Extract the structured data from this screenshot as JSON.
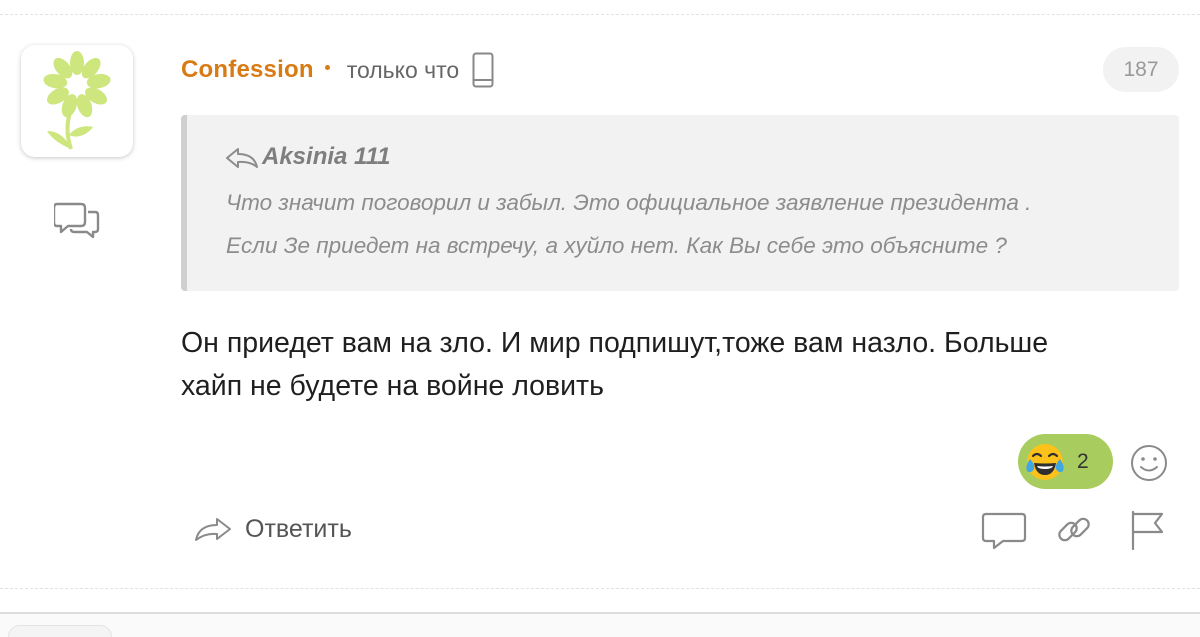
{
  "comment": {
    "author": "Confession",
    "time": "только что",
    "counter": "187",
    "quote": {
      "author": "Aksinia 111",
      "lines": [
        "Что значит поговорил и забыл. Это официальное заявление президента .",
        "Если Зе приедет на встречу, а хуйло нет. Как Вы себе это объясните ?"
      ]
    },
    "text_lines": [
      "Он приедет вам на зло. И мир подпишут,тоже вам назло. Больше",
      "хайп не будете на войне ловить"
    ],
    "reaction": {
      "emoji": "laughing-tears-icon",
      "count": "2",
      "color": "#a9cc5e"
    },
    "actions": {
      "reply_label": "Ответить"
    }
  },
  "colors": {
    "author": "#d97b14",
    "avatar_flower": "#cde67e"
  },
  "icons": [
    "flower-icon",
    "comments-icon",
    "mobile-device-icon",
    "reply-arrow-icon",
    "add-reaction-icon",
    "comment-icon",
    "link-icon",
    "flag-icon"
  ]
}
